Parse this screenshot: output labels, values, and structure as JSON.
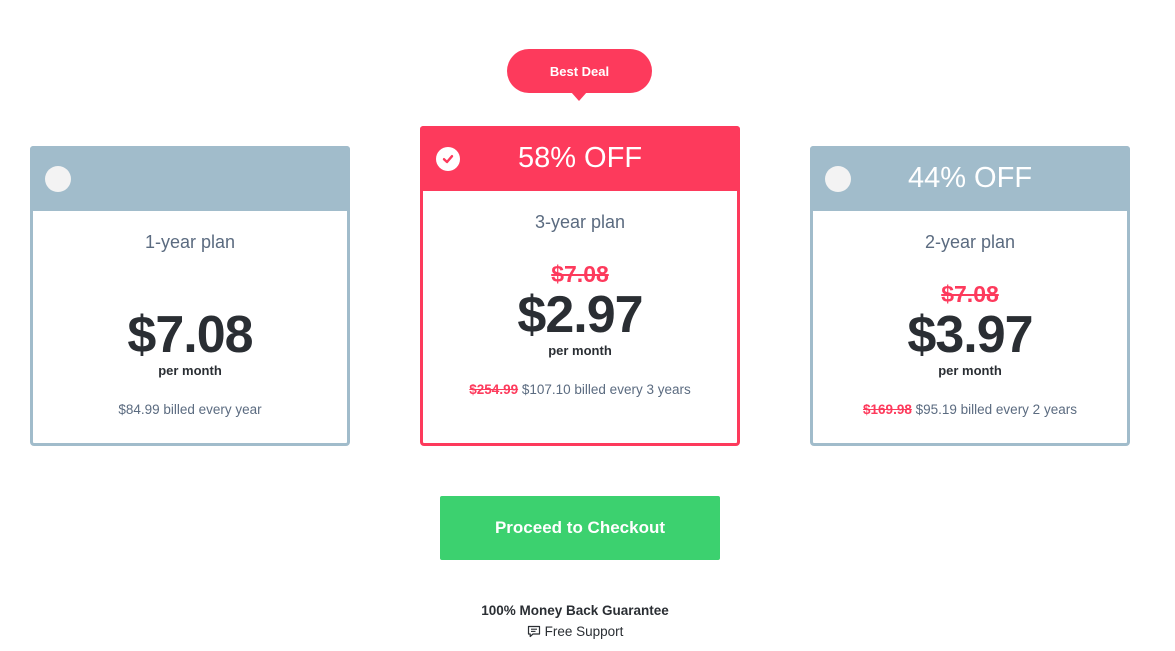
{
  "badge": {
    "label": "Best Deal"
  },
  "plans": [
    {
      "discount": "",
      "name": "1-year plan",
      "old_price": "",
      "price": "$7.08",
      "per": "per month",
      "billed_old": "",
      "billed": "$84.99 billed every year",
      "selected": false
    },
    {
      "discount": "58% OFF",
      "name": "3-year plan",
      "old_price": "$7.08",
      "price": "$2.97",
      "per": "per month",
      "billed_old": "$254.99",
      "billed": "$107.10 billed every 3 years",
      "selected": true
    },
    {
      "discount": "44% OFF",
      "name": "2-year plan",
      "old_price": "$7.08",
      "price": "$3.97",
      "per": "per month",
      "billed_old": "$169.98",
      "billed": "$95.19 billed every 2 years",
      "selected": false
    }
  ],
  "checkout": {
    "label": "Proceed to Checkout"
  },
  "guarantee": {
    "label": "100% Money Back Guarantee"
  },
  "support": {
    "label": "Free Support",
    "icon": "chat-icon"
  },
  "colors": {
    "accent": "#fd3a5c",
    "muted": "#a1bccb",
    "cta": "#3cd16f",
    "text": "#2a2e33",
    "secondary_text": "#5b6b80"
  }
}
